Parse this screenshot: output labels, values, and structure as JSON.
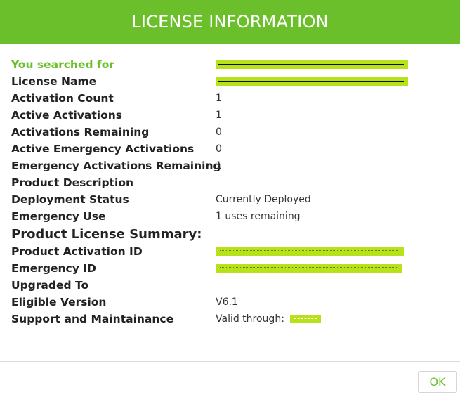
{
  "header": {
    "title": "LICENSE INFORMATION",
    "background_color": "#6bbf2a"
  },
  "rows": [
    {
      "label": "You searched for",
      "value": "",
      "accent": true
    },
    {
      "label": "License Name",
      "value": ""
    },
    {
      "label": "Activation Count",
      "value": "1"
    },
    {
      "label": "Active Activations",
      "value": "1"
    },
    {
      "label": "Activations Remaining",
      "value": "0"
    },
    {
      "label": "Active Emergency Activations",
      "value": "0"
    },
    {
      "label": "Emergency Activations Remaining",
      "value": "1"
    },
    {
      "label": "Product Description",
      "value": ""
    },
    {
      "label": "Deployment Status",
      "value": "Currently Deployed"
    },
    {
      "label": "Emergency Use",
      "value": "1 uses remaining"
    }
  ],
  "summary": {
    "heading": "Product License Summary:",
    "rows": [
      {
        "label": "Product Activation ID",
        "value": ""
      },
      {
        "label": "Emergency ID",
        "value": ""
      },
      {
        "label": "Upgraded To",
        "value": ""
      },
      {
        "label": "Eligible Version",
        "value": "V6.1"
      },
      {
        "label": "Support and Maintainance",
        "value": "Valid through:"
      }
    ]
  },
  "footer": {
    "ok_label": "OK"
  },
  "colors": {
    "accent": "#6bbf2a",
    "redaction_highlight": "#b7e21a"
  }
}
